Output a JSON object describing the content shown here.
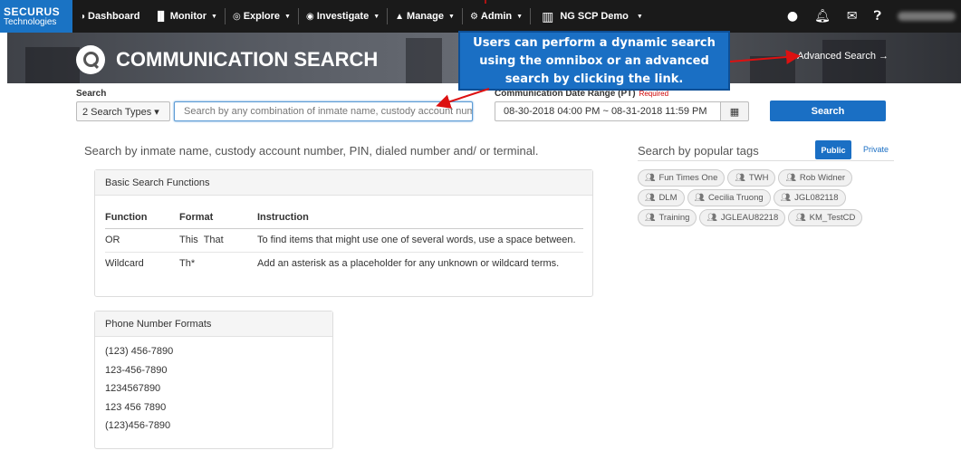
{
  "nav": {
    "brand_line1": "SECURUS",
    "brand_line2": "Technologies",
    "items": [
      {
        "label": "Dashboard",
        "icon": "dashboard-icon",
        "glyph": "◑"
      },
      {
        "label": "Monitor",
        "icon": "bar-chart-icon",
        "glyph": "▐▌"
      },
      {
        "label": "Explore",
        "icon": "compass-icon",
        "glyph": "◎"
      },
      {
        "label": "Investigate",
        "icon": "eye-icon",
        "glyph": "◉"
      },
      {
        "label": "Manage",
        "icon": "user-icon",
        "glyph": "▲"
      },
      {
        "label": "Admin",
        "icon": "gear-icon",
        "glyph": "⚙"
      }
    ],
    "facility": "NG SCP Demo"
  },
  "hero": {
    "title": "COMMUNICATION SEARCH",
    "advanced_link": "Advanced Search →"
  },
  "callout": {
    "text_line1": "Users can perform a dynamic search",
    "text_line2": "using the omnibox or an advanced",
    "text_line3": "search by clicking the link."
  },
  "search": {
    "label": "Search",
    "types_label": "2 Search Types ▾",
    "placeholder": "Search by any combination of inmate name, custody account numb",
    "date_label": "Communication Date Range (PT)",
    "date_required": "Required",
    "date_value": "08-30-2018 04:00 PM ~ 08-31-2018 11:59 PM",
    "search_button": "Search"
  },
  "help_text": "Search by inmate name, custody account number, PIN, dialed number and/ or terminal.",
  "basic_functions": {
    "title": "Basic Search Functions",
    "headers": [
      "Function",
      "Format",
      "Instruction"
    ],
    "rows": [
      [
        "OR",
        "This  That",
        "To find items that might use one of several words, use a space between."
      ],
      [
        "Wildcard",
        "Th*",
        "Add an asterisk as a placeholder for any unknown or wildcard terms."
      ]
    ]
  },
  "phone_formats": {
    "title": "Phone Number Formats",
    "items": [
      "(123) 456-7890",
      "123-456-7890",
      "1234567890",
      "123 456 7890",
      "(123)456-7890"
    ]
  },
  "tags": {
    "title": "Search by popular tags",
    "public_tab": "Public",
    "private_tab": "Private",
    "items": [
      "Fun Times One",
      "TWH",
      "Rob Widner",
      "DLM",
      "Cecilia Truong",
      "JGL082118",
      "Training",
      "JGLEAU82218",
      "KM_TestCD"
    ]
  },
  "colors": {
    "accent": "#1a6fc4",
    "nav_bg": "#1a1a1a",
    "callout_bg": "#1a6fc4"
  }
}
